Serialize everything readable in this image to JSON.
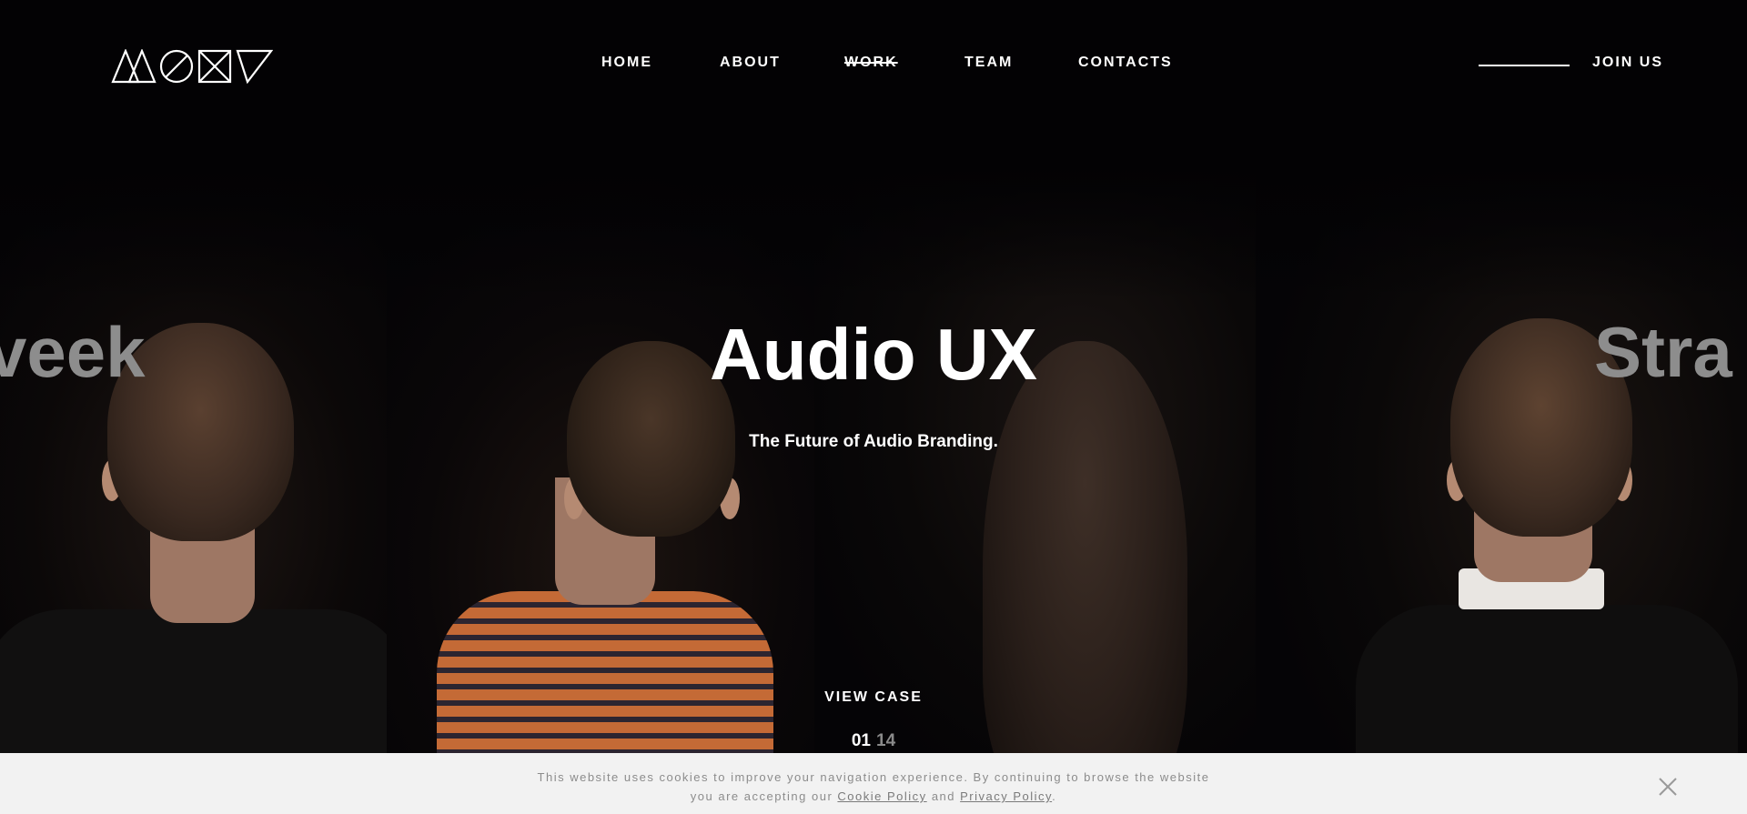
{
  "brand": {
    "logo_text": "MONY"
  },
  "nav": {
    "items": [
      {
        "label": "HOME"
      },
      {
        "label": "ABOUT"
      },
      {
        "label": "WORK",
        "active": true
      },
      {
        "label": "TEAM"
      },
      {
        "label": "CONTACTS"
      }
    ],
    "join_label": "JOIN US"
  },
  "hero": {
    "title": "Audio UX",
    "subtitle": "The Future of Audio Branding.",
    "prev_title_fragment": "veek",
    "next_title_fragment": "Stra",
    "cta_label": "VIEW CASE",
    "slide_current": "01",
    "slide_total": "14"
  },
  "cookie": {
    "text_before": "This website uses cookies to improve your navigation experience. By continuing to browse the website",
    "text_line2": "you are accepting our",
    "cookie_link": "Cookie Policy",
    "and_text": "and",
    "privacy_link": "Privacy Policy",
    "end_text": ".",
    "close_icon": "close-icon"
  },
  "colors": {
    "background": "#050406",
    "text": "#ffffff",
    "faded_title": "#8d8d8d",
    "cookie_bar": "#f2f2f2",
    "cookie_text": "#8c8c8c",
    "shirt_orange": "#c46a36",
    "shirt_stripe": "#2c2530"
  }
}
